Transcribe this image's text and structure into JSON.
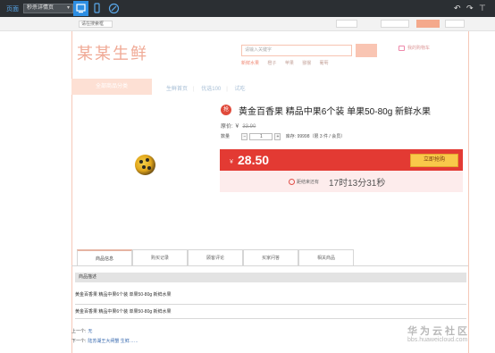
{
  "toolbar": {
    "label": "页面",
    "page_select": "秒杀详情页",
    "devices": [
      "desktop-icon",
      "mobile-icon",
      "link-icon"
    ],
    "right_icons": [
      "undo-icon",
      "redo-icon",
      "pin-icon"
    ]
  },
  "site": {
    "search_small_placeholder": "请在搜索框",
    "logo_text": "某某生鲜",
    "search_placeholder": "请输入关键字",
    "cart_text": "我的购物车",
    "hot_words": [
      "新鲜水果",
      "橙子",
      "苹果",
      "猕猴",
      "葡萄"
    ],
    "category_label": "全部商品分类",
    "nav": [
      "生鲜首页",
      "优选100",
      "试吃"
    ]
  },
  "product": {
    "badge": "抢",
    "title": "黄金百香果 精品中果6个装 单果50-80g 新鲜水果",
    "original_price_label": "原价: ￥",
    "original_price": "33.90",
    "qty_label": "数量",
    "qty_minus": "−",
    "qty_value": "1",
    "qty_plus": "+",
    "stock_text": "库存: 99998（限 3 件 / 会员）",
    "currency": "￥",
    "seckill_price": "28.50",
    "buy_button": "立即抢购",
    "countdown_label": "距结束还有",
    "countdown": "17时13分31秒"
  },
  "tabs": [
    "商品信息",
    "购买记录",
    "顾客评论",
    "买家问答",
    "相关商品"
  ],
  "details": {
    "section_title": "商品描述",
    "desc_line_1": "黄金百香果 精品中果6个装 单果50-80g 新鲜水果",
    "desc_line_2": "黄金百香果 精品中果6个装 单果50-80g 新鲜水果",
    "prev_label": "上一个:",
    "prev_value": "无",
    "next_label": "下一个:",
    "next_value": "陆苏湖王大闸蟹 生鲜……"
  },
  "watermark": {
    "line1": "华为云社区",
    "line2": "bbs.huaweicloud.com"
  },
  "colors": {
    "toolbar_bg": "#2b2f33",
    "accent_blue": "#2d8ee3",
    "price_red": "#e33a33",
    "buy_yellow": "#f9c94a",
    "logo_pink": "#f0aa96"
  }
}
